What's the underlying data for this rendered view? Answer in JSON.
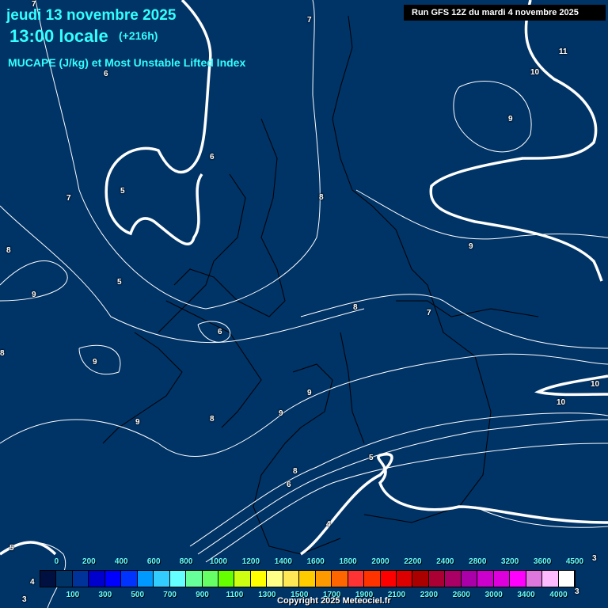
{
  "header": {
    "date": "jeudi 13 novembre 2025",
    "time": "13:00 locale",
    "lead": "(+216h)",
    "product": "MUCAPE (J/kg) et Most Unstable Lifted Index",
    "run": "Run GFS 12Z du mardi 4 novembre 2025"
  },
  "contour_labels": [
    "7",
    "7",
    "6",
    "11",
    "10",
    "9",
    "5",
    "6",
    "7",
    "8",
    "8",
    "9",
    "5",
    "9",
    "8",
    "6",
    "8",
    "7",
    "9",
    "9",
    "9",
    "8",
    "9",
    "10",
    "10",
    "5",
    "8",
    "6",
    "4",
    "5",
    "3",
    "3",
    "3",
    "4"
  ],
  "colorbar": {
    "top_labels": [
      "0",
      "200",
      "400",
      "600",
      "800",
      "1000",
      "1200",
      "1400",
      "1600",
      "1800",
      "2000",
      "2200",
      "2400",
      "2800",
      "3200",
      "3600",
      "4500"
    ],
    "bottom_labels": [
      "100",
      "300",
      "500",
      "700",
      "900",
      "1100",
      "1300",
      "1500",
      "1700",
      "1900",
      "2100",
      "2300",
      "2600",
      "3000",
      "3400",
      "4000"
    ],
    "colors": [
      "#001040",
      "#003366",
      "#003399",
      "#0000cc",
      "#0000ff",
      "#0033ff",
      "#0099ff",
      "#33ccff",
      "#66ffff",
      "#66ff99",
      "#66ff66",
      "#66ff00",
      "#ccff11",
      "#ffff00",
      "#ffff88",
      "#ffe855",
      "#ffcc00",
      "#ff9900",
      "#ff6600",
      "#ff3333",
      "#ff3300",
      "#ff0000",
      "#dd0000",
      "#aa0000",
      "#aa0033",
      "#aa0066",
      "#aa00aa",
      "#cc00cc",
      "#dd00dd",
      "#ff00ff",
      "#dd77dd",
      "#ffbbff",
      "#ffffff"
    ]
  },
  "copyright": "Copyright 2025 Meteociel.fr"
}
